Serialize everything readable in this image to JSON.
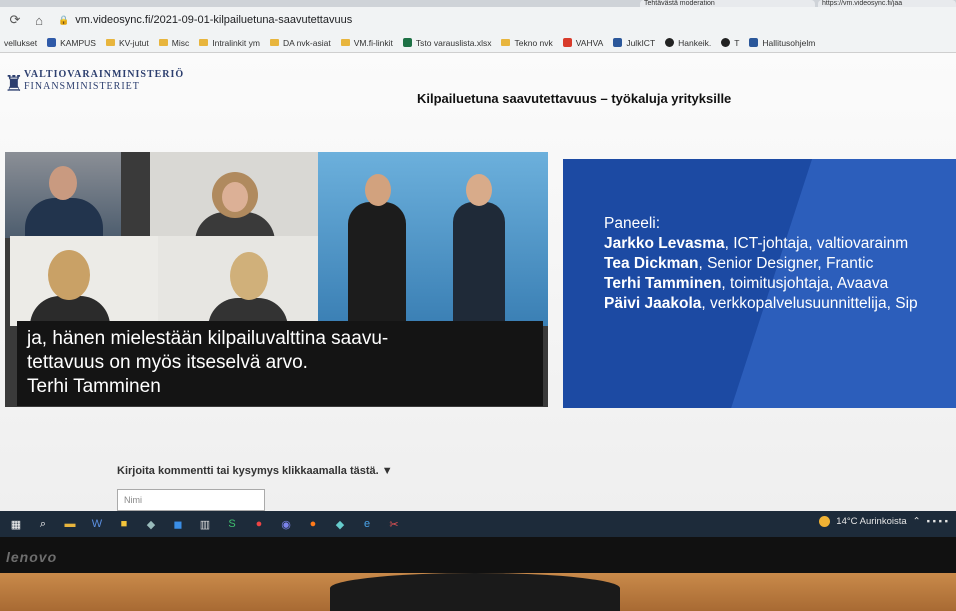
{
  "browser": {
    "tabs": [
      "Tehtävästä moderation",
      "https://vm.videosync.fi/jaa"
    ],
    "url": "vm.videosync.fi/2021-09-01-kilpailuetuna-saavutettavuus",
    "bookmarks": [
      "vellukset",
      "KAMPUS",
      "KV-jutut",
      "Misc",
      "Intralinkit ym",
      "DA nvk-asiat",
      "VM.fi-linkit",
      "Tsto varauslista.xlsx",
      "Tekno nvk",
      "VAHVA",
      "JulkICT",
      "Hankeik.",
      "T",
      "Hallitusohjelm"
    ]
  },
  "page": {
    "logo_line1": "VALTIOVARAINMINISTERIÖ",
    "logo_line2": "FINANSMINISTERIET",
    "title": "Kilpailuetuna saavutettavuus – työkaluja yrityksille",
    "caption_line1": "ja, hänen mielestään kilpailuvalttina saavu-",
    "caption_line2": "tettavuus on myös itseselvä arvo.",
    "caption_line3": "Terhi Tamminen",
    "slide": {
      "heading": "Paneeli:",
      "rows": [
        {
          "name": "Jarkko Levasma",
          "role": ", ICT-johtaja, valtiovarainm"
        },
        {
          "name": "Tea Dickman",
          "role": ", Senior Designer, Frantic"
        },
        {
          "name": "Terhi Tamminen",
          "role": ", toimitusjohtaja, Avaava"
        },
        {
          "name": "Päivi Jaakola",
          "role": ", verkkopalvelusuunnittelija, Sip"
        }
      ]
    },
    "comment_prompt": "Kirjoita kommentti tai kysymys klikkaamalla tästä. ▼",
    "name_placeholder": "Nimi"
  },
  "taskbar": {
    "weather": "14°C Aurinkoista"
  },
  "monitor_brand": "lenovo"
}
